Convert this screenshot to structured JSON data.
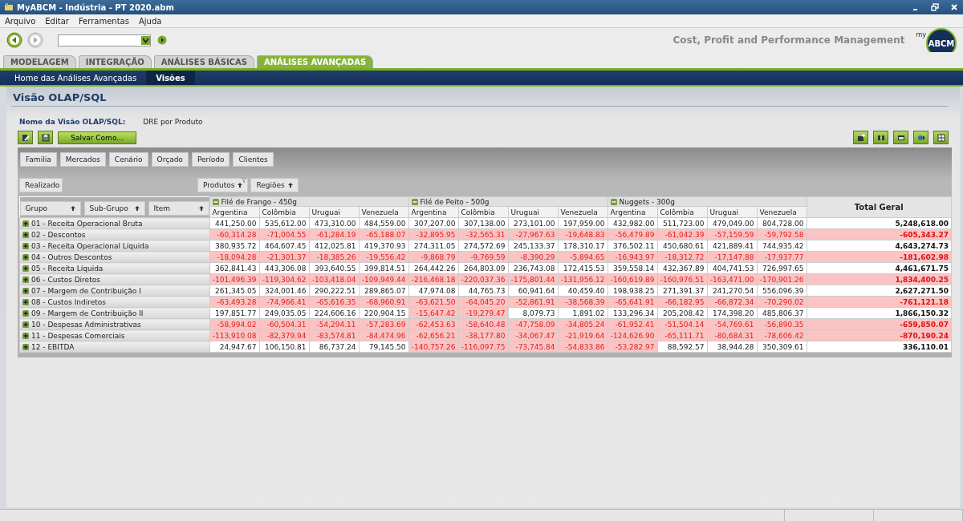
{
  "window": {
    "title": "MyABCM - Indústria - PT 2020.abm"
  },
  "menu": [
    "Arquivo",
    "Editar",
    "Ferramentas",
    "Ajuda"
  ],
  "brand": {
    "tagline": "Cost, Profit and Performance Management",
    "logo_prefix": "my",
    "logo": "ABCM"
  },
  "tabs": [
    {
      "label": "MODELAGEM",
      "selected": false
    },
    {
      "label": "INTEGRAÇÃO",
      "selected": false
    },
    {
      "label": "ANÁLISES BÁSICAS",
      "selected": false
    },
    {
      "label": "ANÁLISES AVANÇADAS",
      "selected": true
    }
  ],
  "subnav": [
    {
      "label": "Home das Análises Avançadas",
      "selected": false
    },
    {
      "label": "Visões",
      "selected": true
    }
  ],
  "page_title": "Visão OLAP/SQL",
  "view_name": {
    "label": "Nome da Visão OLAP/SQL:",
    "value": "DRE por Produto"
  },
  "save_as_button": "Salvar Como...",
  "filter_fields": [
    "Familia",
    "Mercados",
    "Cenário",
    "Orçado",
    "Período",
    "Clientes"
  ],
  "data_field": "Realizado",
  "column_fields": [
    "Produtos",
    "Regiões"
  ],
  "row_fields": [
    "Grupo",
    "Sub-Grupo",
    "Item"
  ],
  "column_groups": [
    {
      "name": "Filé de Frango - 450g",
      "columns": [
        "Argentina",
        "Colômbia",
        "Uruguai",
        "Venezuela"
      ]
    },
    {
      "name": "Filé de Peito - 500g",
      "columns": [
        "Argentina",
        "Colômbia",
        "Uruguai",
        "Venezuela"
      ]
    },
    {
      "name": "Nuggets - 300g",
      "columns": [
        "Argentina",
        "Colômbia",
        "Uruguai",
        "Venezuela"
      ]
    }
  ],
  "total_header": "Total Geral",
  "rows": [
    {
      "label": "01 - Receita Operacional Bruta",
      "cells": [
        "441,250.00",
        "535,612.00",
        "473,310.00",
        "484,559.00",
        "307,207.00",
        "307,138.00",
        "273,101.00",
        "197,959.00",
        "432,982.00",
        "511,723.00",
        "479,049.00",
        "804,728.00",
        "5,248,618.00"
      ],
      "negative": [
        false,
        false,
        false,
        false,
        false,
        false,
        false,
        false,
        false,
        false,
        false,
        false,
        false
      ]
    },
    {
      "label": "02 - Descontos",
      "cells": [
        "-60,314.28",
        "-71,004.55",
        "-61,284.19",
        "-65,188.07",
        "-32,895.95",
        "-32,565.31",
        "-27,967.63",
        "-19,648.83",
        "-56,479.89",
        "-61,042.39",
        "-57,159.59",
        "-59,792.58",
        "-605,343.27"
      ],
      "negative": [
        true,
        true,
        true,
        true,
        true,
        true,
        true,
        true,
        true,
        true,
        true,
        true,
        true
      ]
    },
    {
      "label": "03 - Receita Operacional Líquida",
      "cells": [
        "380,935.72",
        "464,607.45",
        "412,025.81",
        "419,370.93",
        "274,311.05",
        "274,572.69",
        "245,133.37",
        "178,310.17",
        "376,502.11",
        "450,680.61",
        "421,889.41",
        "744,935.42",
        "4,643,274.73"
      ],
      "negative": [
        false,
        false,
        false,
        false,
        false,
        false,
        false,
        false,
        false,
        false,
        false,
        false,
        false
      ]
    },
    {
      "label": "04 - Outros Descontos",
      "cells": [
        "-18,094.28",
        "-21,301.37",
        "-18,385.26",
        "-19,556.42",
        "-9,868.79",
        "-9,769.59",
        "-8,390.29",
        "-5,894.65",
        "-16,943.97",
        "-18,312.72",
        "-17,147.88",
        "-17,937.77",
        "-181,602.98"
      ],
      "negative": [
        true,
        true,
        true,
        true,
        true,
        true,
        true,
        true,
        true,
        true,
        true,
        true,
        true
      ]
    },
    {
      "label": "05 - Receita Líquida",
      "cells": [
        "362,841.43",
        "443,306.08",
        "393,640.55",
        "399,814.51",
        "264,442.26",
        "264,803.09",
        "236,743.08",
        "172,415.53",
        "359,558.14",
        "432,367.89",
        "404,741.53",
        "726,997.65",
        "4,461,671.75"
      ],
      "negative": [
        false,
        false,
        false,
        false,
        false,
        false,
        false,
        false,
        false,
        false,
        false,
        false,
        false
      ]
    },
    {
      "label": "06 - Custos Diretos",
      "cells": [
        "-101,496.39",
        "-119,304.62",
        "-103,418.04",
        "-109,949.44",
        "-216,468.18",
        "-220,037.36",
        "-175,801.44",
        "-131,956.12",
        "-160,619.89",
        "-160,976.51",
        "-163,471.00",
        "-170,901.26",
        "1,834,400.25"
      ],
      "negative": [
        true,
        true,
        true,
        true,
        true,
        true,
        true,
        true,
        true,
        true,
        true,
        true,
        true
      ]
    },
    {
      "label": "07 - Margem de Contribuição I",
      "cells": [
        "261,345.05",
        "324,001.46",
        "290,222.51",
        "289,865.07",
        "47,974.08",
        "44,765.73",
        "60,941.64",
        "40,459.40",
        "198,938.25",
        "271,391.37",
        "241,270.54",
        "556,096.39",
        "2,627,271.50"
      ],
      "negative": [
        false,
        false,
        false,
        false,
        false,
        false,
        false,
        false,
        false,
        false,
        false,
        false,
        false
      ]
    },
    {
      "label": "08 - Custos Indiretos",
      "cells": [
        "-63,493.28",
        "-74,966.41",
        "-65,616.35",
        "-68,960.91",
        "-63,621.50",
        "-64,045.20",
        "-52,861.91",
        "-38,568.39",
        "-65,641.91",
        "-66,182.95",
        "-66,872.34",
        "-70,290.02",
        "-761,121.18"
      ],
      "negative": [
        true,
        true,
        true,
        true,
        true,
        true,
        true,
        true,
        true,
        true,
        true,
        true,
        true
      ]
    },
    {
      "label": "09 - Margem de Contribuição II",
      "cells": [
        "197,851.77",
        "249,035.05",
        "224,606.16",
        "220,904.15",
        "-15,647.42",
        "-19,279.47",
        "8,079.73",
        "1,891.02",
        "133,296.34",
        "205,208.42",
        "174,398.20",
        "485,806.37",
        "1,866,150.32"
      ],
      "negative": [
        false,
        false,
        false,
        false,
        true,
        true,
        false,
        false,
        false,
        false,
        false,
        false,
        false
      ]
    },
    {
      "label": "10 - Despesas Administrativas",
      "cells": [
        "-58,994.02",
        "-60,504.31",
        "-54,294.11",
        "-57,283.69",
        "-62,453.63",
        "-58,640.48",
        "-47,758.09",
        "-34,805.24",
        "-61,952.41",
        "-51,504.14",
        "-54,769.61",
        "-56,890.35",
        "-659,850.07"
      ],
      "negative": [
        true,
        true,
        true,
        true,
        true,
        true,
        true,
        true,
        true,
        true,
        true,
        true,
        true
      ]
    },
    {
      "label": "11 - Despesas Comerciais",
      "cells": [
        "-113,910.08",
        "-82,379.94",
        "-83,574.81",
        "-84,474.96",
        "-62,656.21",
        "-38,177.80",
        "-34,067.47",
        "-21,919.64",
        "-124,626.90",
        "-65,111.71",
        "-80,684.31",
        "-78,606.42",
        "-870,190.24"
      ],
      "negative": [
        true,
        true,
        true,
        true,
        true,
        true,
        true,
        true,
        true,
        true,
        true,
        true,
        true
      ]
    },
    {
      "label": "12 - EBITDA",
      "cells": [
        "24,947.67",
        "106,150.81",
        "86,737.24",
        "79,145.50",
        "-140,757.26",
        "-116,097.75",
        "-73,745.84",
        "-54,833.86",
        "-53,282.97",
        "88,592.57",
        "38,944.28",
        "350,309.61",
        "336,110.01"
      ],
      "negative": [
        false,
        false,
        false,
        false,
        true,
        true,
        true,
        true,
        true,
        false,
        false,
        false,
        false
      ]
    }
  ]
}
